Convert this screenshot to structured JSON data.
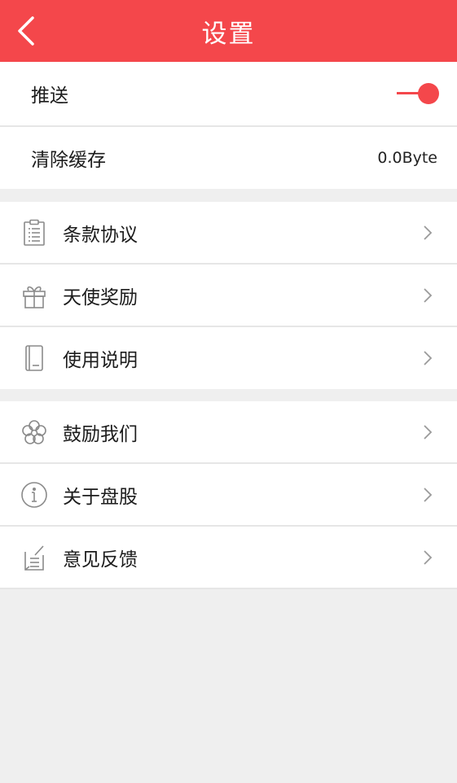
{
  "theme": {
    "accent": "#f4474b",
    "background": "#efefef"
  },
  "header": {
    "title": "设置",
    "back_icon": "back-arrow-icon"
  },
  "settings": {
    "push": {
      "label": "推送",
      "enabled": true
    },
    "clear_cache": {
      "label": "清除缓存",
      "value": "0.0Byte"
    }
  },
  "group1": [
    {
      "label": "条款协议",
      "icon": "clipboard-icon"
    },
    {
      "label": "天使奖励",
      "icon": "gift-icon"
    },
    {
      "label": "使用说明",
      "icon": "manual-icon"
    }
  ],
  "group2": [
    {
      "label": "鼓励我们",
      "icon": "flower-icon"
    },
    {
      "label": "关于盘股",
      "icon": "info-icon"
    },
    {
      "label": "意见反馈",
      "icon": "feedback-icon"
    }
  ]
}
